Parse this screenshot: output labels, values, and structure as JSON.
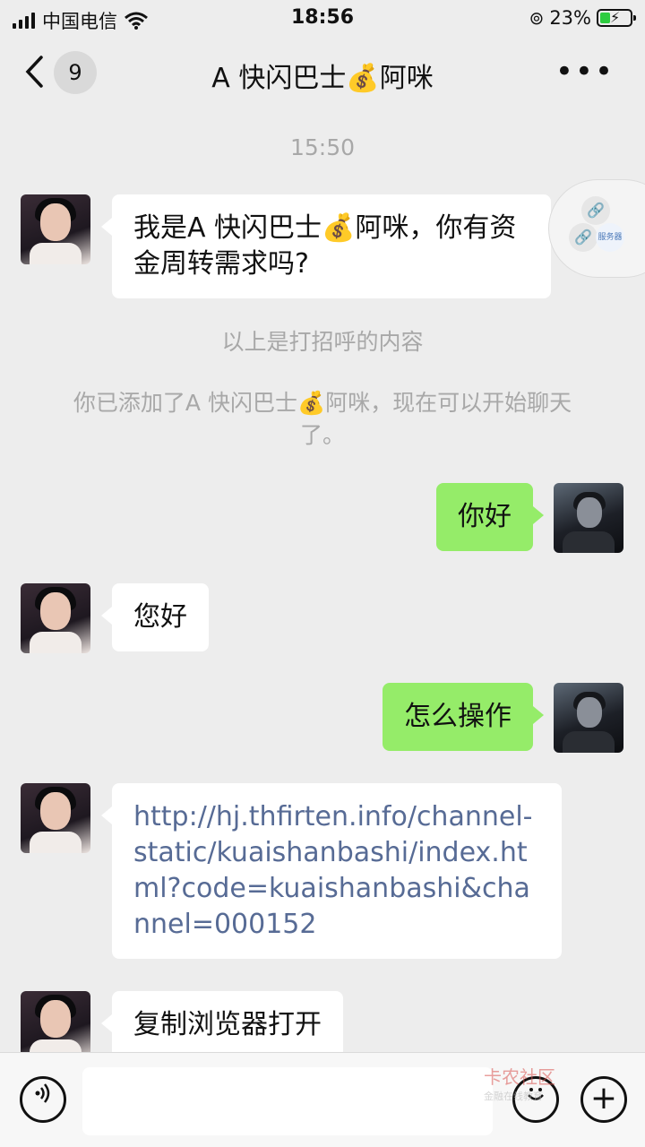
{
  "status": {
    "carrier": "中国电信",
    "time": "18:56",
    "battery": "23%"
  },
  "header": {
    "back_count": "9",
    "title": "A 快闪巴士💰阿咪",
    "more": "•••"
  },
  "chat": {
    "timestamp": "15:50",
    "system_greeting": "以上是打招呼的内容",
    "system_added": "你已添加了A 快闪巴士💰阿咪，现在可以开始聊天了。",
    "messages": [
      {
        "from": "them",
        "text": "我是A 快闪巴士💰阿咪，你有资金周转需求吗?"
      },
      {
        "from": "me",
        "text": "你好"
      },
      {
        "from": "them",
        "text": "您好"
      },
      {
        "from": "me",
        "text": "怎么操作"
      },
      {
        "from": "them",
        "text": "http://hj.thfirten.info/channel-static/kuaishanbashi/index.html?code=kuaishanbashi&channel=000152"
      },
      {
        "from": "them",
        "text": "复制浏览器打开"
      }
    ]
  },
  "floating": {
    "label": "服务器"
  },
  "watermark": {
    "title": "卡农社区",
    "subtitle": "金融在线教育"
  }
}
